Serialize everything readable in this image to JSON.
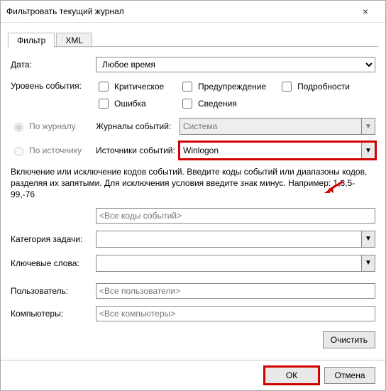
{
  "window": {
    "title": "Фильтровать текущий журнал",
    "close_label": "×"
  },
  "tabs": {
    "filter": "Фильтр",
    "xml": "XML"
  },
  "labels": {
    "date": "Дата:",
    "level": "Уровень события:",
    "by_journal": "По журналу",
    "by_source": "По источнику",
    "journals": "Журналы событий:",
    "sources": "Источники событий:",
    "category": "Категория задачи:",
    "keywords": "Ключевые слова:",
    "user": "Пользователь:",
    "computers": "Компьютеры:"
  },
  "date_select": "Любое время",
  "level_checks": {
    "critical": "Критическое",
    "warning": "Предупреждение",
    "verbose": "Подробности",
    "error": "Ошибка",
    "info": "Сведения"
  },
  "journals_value": "Система",
  "sources_value": "Winlogon",
  "description": "Включение или исключение кодов событий. Введите коды событий или диапазоны кодов, разделяя их запятыми. Для исключения условия введите знак минус. Например: 1,3,5-99,-76",
  "placeholders": {
    "all_codes": "<Все коды событий>",
    "all_users": "<Все пользователи>",
    "all_computers": "<Все компьютеры>"
  },
  "buttons": {
    "clear": "Очистить",
    "ok": "ОК",
    "cancel": "Отмена"
  }
}
